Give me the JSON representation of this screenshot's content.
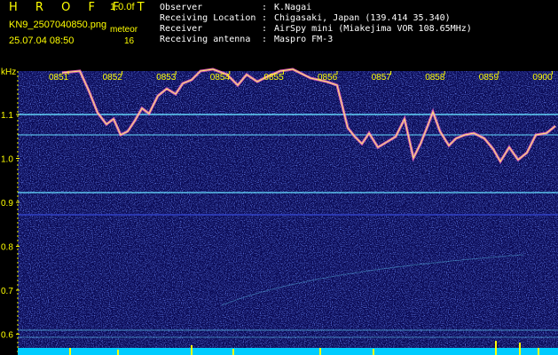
{
  "header": {
    "brand": "H R O F F T",
    "version": "1.0.0f",
    "filename": "KN9_2507040850.png",
    "datetime": "25.07.04 08:50",
    "meteor_label": "meteor",
    "meteor_count": "16"
  },
  "info": [
    {
      "key": "Observer",
      "sep": ":",
      "value": "K.Nagai"
    },
    {
      "key": "Receiving Location",
      "sep": ":",
      "value": "Chigasaki, Japan (139.414 35.340)"
    },
    {
      "key": "Receiver",
      "sep": ":",
      "value": "AirSpy mini (Miakejima VOR 108.65MHz)"
    },
    {
      "key": "Receiving antenna",
      "sep": ":",
      "value": "Maspro FM-3"
    }
  ],
  "spectrogram": {
    "unit_label": "kHz",
    "time_labels": [
      "0851",
      "0852",
      "0853",
      "0854",
      "0855",
      "0856",
      "0857",
      "0858",
      "0859",
      "0900"
    ],
    "freq_labels": [
      "1.1",
      "1.0",
      "0.9",
      "0.8",
      "0.7",
      "0.6"
    ],
    "colors": {
      "background": "#0a0a55",
      "noise": "#3344cc",
      "carrier": "#66ddff",
      "trace": "#ff66cc",
      "trace_core": "#ffff66",
      "text": "#ffff00",
      "bottom_bar": "#00ccff"
    }
  }
}
